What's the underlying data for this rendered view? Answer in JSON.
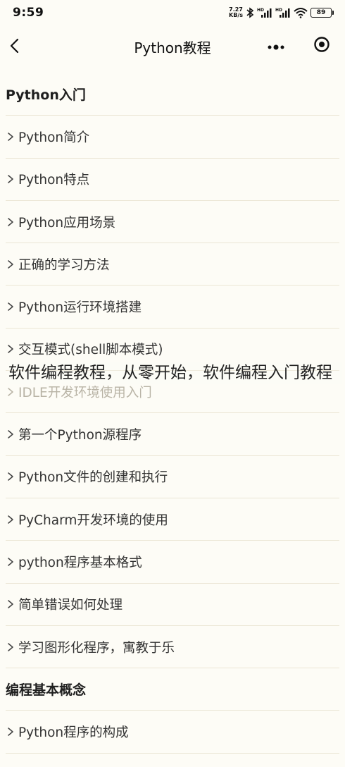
{
  "status_bar": {
    "time": "9:59",
    "net_speed_value": "7.27",
    "net_speed_unit": "KB/s",
    "signal1_label": "HD",
    "signal2_label": "HD",
    "battery": "89"
  },
  "nav": {
    "title": "Python教程",
    "icons": {
      "back": "chevron-left-icon",
      "more": "more-dots-icon",
      "close": "target-close-icon"
    }
  },
  "menu": [
    {
      "type": "section",
      "label": "Python入门"
    },
    {
      "type": "item",
      "label": "Python简介"
    },
    {
      "type": "item",
      "label": "Python特点"
    },
    {
      "type": "item",
      "label": "Python应用场景"
    },
    {
      "type": "item",
      "label": "正确的学习方法"
    },
    {
      "type": "item",
      "label": "Python运行环境搭建"
    },
    {
      "type": "item",
      "label": "交互模式(shell脚本模式)"
    },
    {
      "type": "item",
      "label": "IDLE开发环境使用入门",
      "dim": true
    },
    {
      "type": "item",
      "label": "第一个Python源程序"
    },
    {
      "type": "item",
      "label": "Python文件的创建和执行"
    },
    {
      "type": "item",
      "label": "PyCharm开发环境的使用"
    },
    {
      "type": "item",
      "label": "python程序基本格式"
    },
    {
      "type": "item",
      "label": "简单错误如何处理"
    },
    {
      "type": "item",
      "label": "学习图形化程序，寓教于乐"
    },
    {
      "type": "section",
      "label": "编程基本概念"
    },
    {
      "type": "item",
      "label": "Python程序的构成"
    }
  ],
  "overlay": {
    "caption": "软件编程教程，从零开始，软件编程入门教程"
  },
  "colors": {
    "background": "#fdfcf6",
    "divider": "#ebe6d5",
    "text": "#333333"
  }
}
